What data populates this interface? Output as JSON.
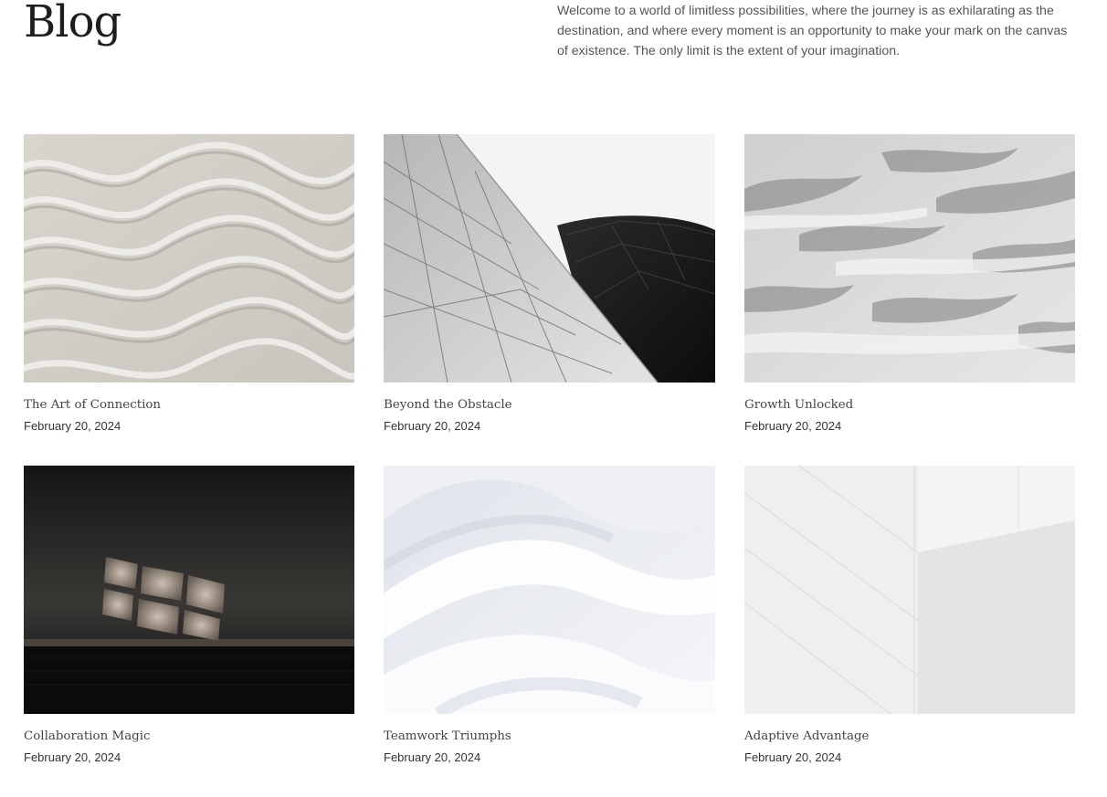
{
  "header": {
    "title": "Blog",
    "intro": "Welcome to a world of limitless possibilities, where the journey is as exhilarating as the destination, and where every moment is an opportunity to make your mark on the canvas of existence. The only limit is the extent of your imagination."
  },
  "posts": [
    {
      "title": "The Art of Connection",
      "date": "February 20, 2024",
      "image": "sand-ripples"
    },
    {
      "title": "Beyond the Obstacle",
      "date": "February 20, 2024",
      "image": "architecture-facade"
    },
    {
      "title": "Growth Unlocked",
      "date": "February 20, 2024",
      "image": "sand-dunes"
    },
    {
      "title": "Collaboration Magic",
      "date": "February 20, 2024",
      "image": "shadow-light-window"
    },
    {
      "title": "Teamwork Triumphs",
      "date": "February 20, 2024",
      "image": "white-waves"
    },
    {
      "title": "Adaptive Advantage",
      "date": "February 20, 2024",
      "image": "white-wall-corner"
    }
  ]
}
